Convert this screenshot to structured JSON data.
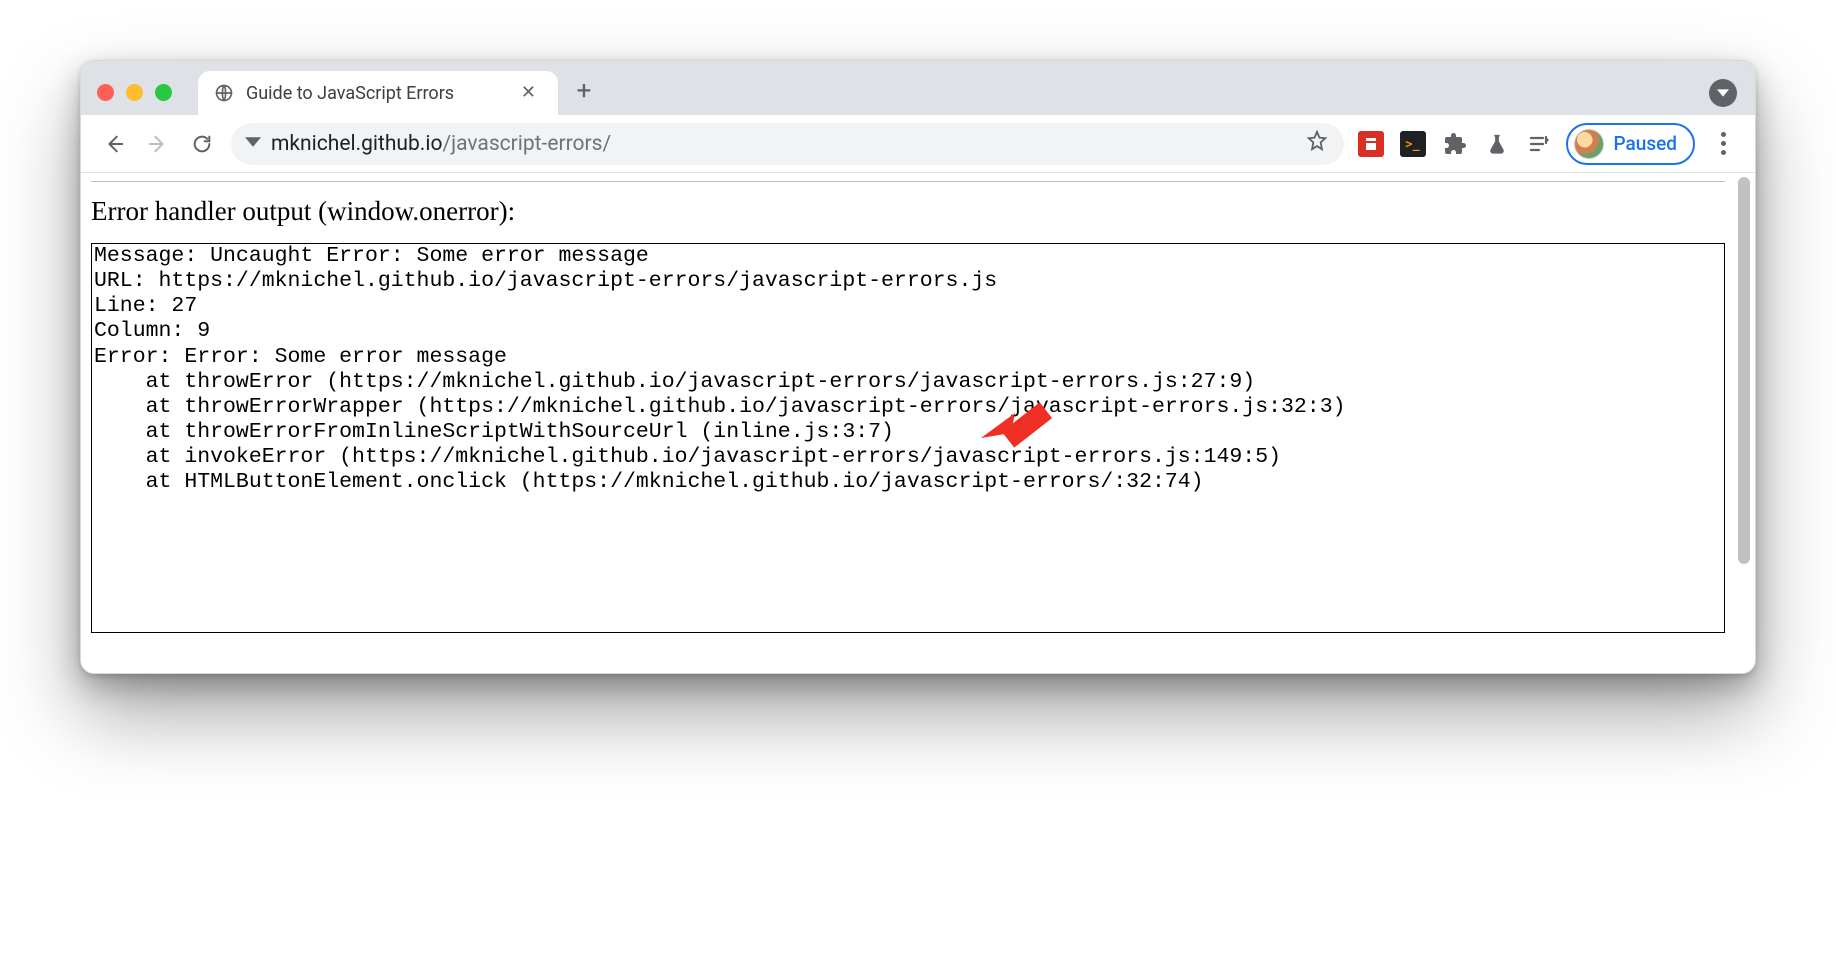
{
  "tab": {
    "title": "Guide to JavaScript Errors"
  },
  "url": {
    "host": "mknichel.github.io",
    "path": "/javascript-errors/"
  },
  "profile": {
    "label": "Paused"
  },
  "page": {
    "heading": "Error handler output (window.onerror):",
    "lines": {
      "l0": "Message: Uncaught Error: Some error message",
      "l1": "URL: https://mknichel.github.io/javascript-errors/javascript-errors.js",
      "l2": "Line: 27",
      "l3": "Column: 9",
      "l4": "Error: Error: Some error message",
      "l5": "    at throwError (https://mknichel.github.io/javascript-errors/javascript-errors.js:27:9)",
      "l6": "    at throwErrorWrapper (https://mknichel.github.io/javascript-errors/javascript-errors.js:32:3)",
      "l7": "    at throwErrorFromInlineScriptWithSourceUrl (inline.js:3:7)",
      "l8": "    at invokeError (https://mknichel.github.io/javascript-errors/javascript-errors.js:149:5)",
      "l9": "    at HTMLButtonElement.onclick (https://mknichel.github.io/javascript-errors/:32:74)"
    }
  }
}
